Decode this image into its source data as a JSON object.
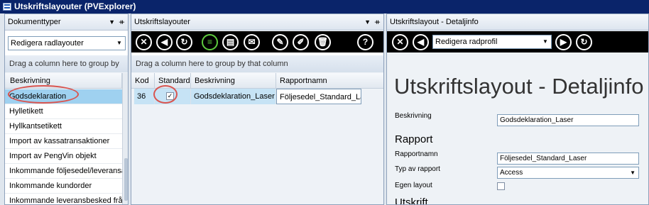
{
  "window": {
    "title": "Utskriftslayouter (PVExplorer)"
  },
  "left_pane": {
    "title": "Dokumenttyper",
    "pin_glyph": "▼",
    "pushpin_glyph": "ᚑ",
    "combo_value": "Redigera radlayouter",
    "group_hint": "Drag a column here to group by that...",
    "column_header": "Beskrivning",
    "rows": [
      "Godsdeklaration",
      "Hylletikett",
      "Hyllkantsetikett",
      "Import av kassatransaktioner",
      "Import av PengVin objekt",
      "Inkommande följesedel/leveransav",
      "Inkommande kundorder",
      "Inkommande leveransbesked från"
    ],
    "selected_index": 0
  },
  "middle_pane": {
    "title": "Utskriftslayouter",
    "pin_glyph": "▼",
    "pushpin_glyph": "ᚑ",
    "toolbar_icons": [
      "cancel-icon",
      "back-icon",
      "refresh-icon",
      "new-record-icon",
      "print-icon",
      "delete-mail-icon",
      "edit-icon",
      "edit-form-icon",
      "trash-icon",
      "help-icon"
    ],
    "toolbar_glyphs": [
      "✕",
      "◀",
      "↻",
      "≡",
      "▤",
      "✉",
      "✎",
      "✐",
      "🗑",
      "?"
    ],
    "group_hint": "Drag a column here to group by that column",
    "columns": [
      "Kod",
      "Standard",
      "Beskrivning",
      "Rapportnamn"
    ],
    "rows": [
      {
        "kod": "36",
        "standard_checked": true,
        "check_glyph": "✓",
        "beskrivning": "Godsdeklaration_Laser",
        "rapportnamn": "Följesedel_Standard_Laser"
      }
    ]
  },
  "right_pane": {
    "title": "Utskriftslayout - Detaljinfo",
    "toolbar_icons": [
      "cancel-icon",
      "back-icon",
      "forward-icon",
      "refresh-icon"
    ],
    "toolbar_glyphs": [
      "✕",
      "◀",
      "▶",
      "↻"
    ],
    "combo_value": "Redigera radprofil",
    "heading": "Utskriftslayout - Detaljinfo",
    "beskrivning_label": "Beskrivning",
    "beskrivning_value": "Godsdeklaration_Laser",
    "rapport_section": "Rapport",
    "rapportnamn_label": "Rapportnamn",
    "rapportnamn_value": "Följesedel_Standard_Laser",
    "typ_label": "Typ av rapport",
    "typ_value": "Access",
    "egen_layout_label": "Egen layout",
    "egen_layout_checked": false,
    "utskrift_section": "Utskrift"
  },
  "colors": {
    "title_bar": "#0a246a",
    "selection": "#9fd1f0",
    "annotation": "#d9544f",
    "toolbar": "#000000",
    "new_icon": "#5ecb3f"
  }
}
